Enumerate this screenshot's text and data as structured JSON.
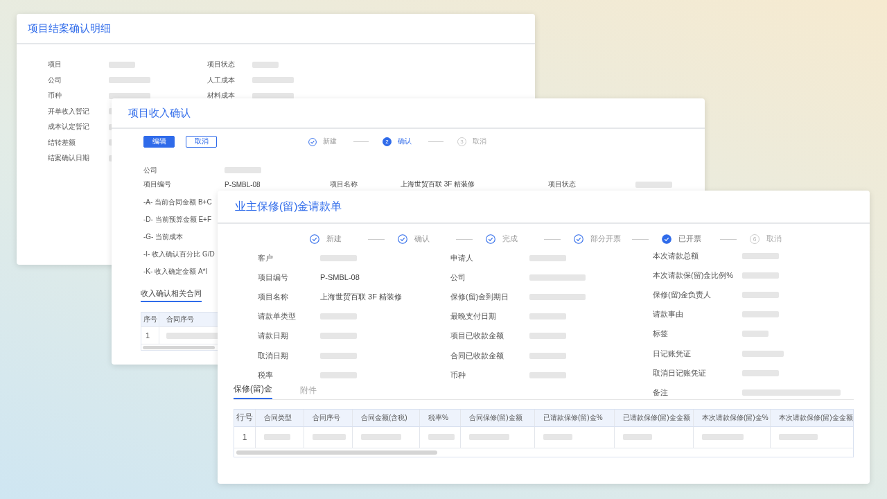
{
  "closing_detail": {
    "title": "项目结案确认明细",
    "left_fields": [
      {
        "label": "项目",
        "kind": "xs"
      },
      {
        "label": "公司",
        "kind": "m"
      },
      {
        "label": "币种",
        "kind": "m"
      },
      {
        "label": "开单收入暂记",
        "kind": "m"
      },
      {
        "label": "成本认定暂记",
        "kind": "m"
      },
      {
        "label": "结转差额",
        "kind": "m"
      },
      {
        "label": "结案确认日期",
        "kind": "m"
      }
    ],
    "right_fields": [
      {
        "label": "项目状态",
        "kind": "xs"
      },
      {
        "label": "人工成本",
        "kind": "m"
      },
      {
        "label": "材料成本",
        "kind": "m"
      }
    ]
  },
  "revenue_confirmation": {
    "title": "项目收入确认",
    "buttons": [
      {
        "label": "编辑",
        "kind": "primary"
      },
      {
        "label": "取消",
        "kind": "outline"
      }
    ],
    "steps": [
      {
        "label": "新建",
        "done": true,
        "selected": false
      },
      {
        "label": "确认",
        "done": false,
        "selected": true,
        "number": "2"
      },
      {
        "label": "取消",
        "done": false,
        "selected": false,
        "number": "3"
      }
    ],
    "fields": [
      [
        {
          "label": "公司",
          "kind": "s"
        }
      ],
      [
        {
          "label": "项目编号",
          "kind": "text",
          "value": "P-SMBL-08"
        },
        {
          "label": "项目名称",
          "kind": "text",
          "value": "上海世贸百联 3F 精装修"
        },
        {
          "label": "项目状态",
          "kind": "s"
        }
      ]
    ],
    "formula_labels": [
      "-A- 当前合同金额 B+C",
      "-D- 当前预算金额 E+F",
      "-G- 当前成本",
      "-I- 收入确认百分比 G/D",
      "-K- 收入确定金额 A*I"
    ],
    "tabs": [
      {
        "label": "收入确认相关合同",
        "selected": true
      }
    ],
    "table": {
      "columns": [
        "序号",
        "合同序号"
      ],
      "rows": [
        {
          "number": "1"
        }
      ]
    }
  },
  "retention_request": {
    "title": "业主保修(留)金请款单",
    "steps": [
      {
        "label": "新建",
        "done": true,
        "selected": false
      },
      {
        "label": "确认",
        "done": true,
        "selected": false
      },
      {
        "label": "完成",
        "done": true,
        "selected": false
      },
      {
        "label": "部分开票",
        "done": true,
        "selected": false
      },
      {
        "label": "已开票",
        "done": true,
        "selected": true
      },
      {
        "label": "取消",
        "done": false,
        "selected": false,
        "number": "6"
      }
    ],
    "columns": [
      [
        {
          "label": "客户",
          "kind": "s"
        },
        {
          "label": "项目编号",
          "kind": "text",
          "value": "P-SMBL-08"
        },
        {
          "label": "项目名称",
          "kind": "text",
          "value": "上海世贸百联 3F 精装修"
        },
        {
          "label": "请款单类型",
          "kind": "s"
        },
        {
          "label": "请款日期",
          "kind": "s"
        },
        {
          "label": "取消日期",
          "kind": "s"
        },
        {
          "label": "税率",
          "kind": "s"
        }
      ],
      [
        {
          "label": "申请人",
          "kind": "s"
        },
        {
          "label": "公司",
          "kind": "l"
        },
        {
          "label": "保修(留)金到期日",
          "kind": "l"
        },
        {
          "label": "最晚支付日期",
          "kind": "s"
        },
        {
          "label": "项目已收款金额",
          "kind": "s"
        },
        {
          "label": "合同已收款金额",
          "kind": "s"
        },
        {
          "label": "币种",
          "kind": "s"
        }
      ],
      [
        {
          "label": "本次请款总额",
          "kind": "s"
        },
        {
          "label": "本次请款保(留)金比例%",
          "kind": "s"
        },
        {
          "label": "保修(留)金负责人",
          "kind": "s"
        },
        {
          "label": "请款事由",
          "kind": "s"
        },
        {
          "label": "标签",
          "kind": "xs"
        },
        {
          "label": "日记账凭证",
          "kind": "m"
        },
        {
          "label": "取消日记账凭证",
          "kind": "s"
        },
        {
          "label": "备注",
          "kind": "xl"
        }
      ]
    ],
    "tabs": [
      {
        "label": "保修(留)金",
        "selected": true
      },
      {
        "label": "附件",
        "selected": false
      }
    ],
    "table": {
      "columns": [
        "行号",
        "合同类型",
        "合同序号",
        "合同金额(含税)",
        "税率%",
        "合同保修(留)金额",
        "已请款保修(留)金%",
        "已请款保修(留)金金额",
        "本次请款保修(留)金%",
        "本次请款保修(留)金金额"
      ],
      "rows": [
        {
          "number": "1"
        }
      ]
    }
  }
}
